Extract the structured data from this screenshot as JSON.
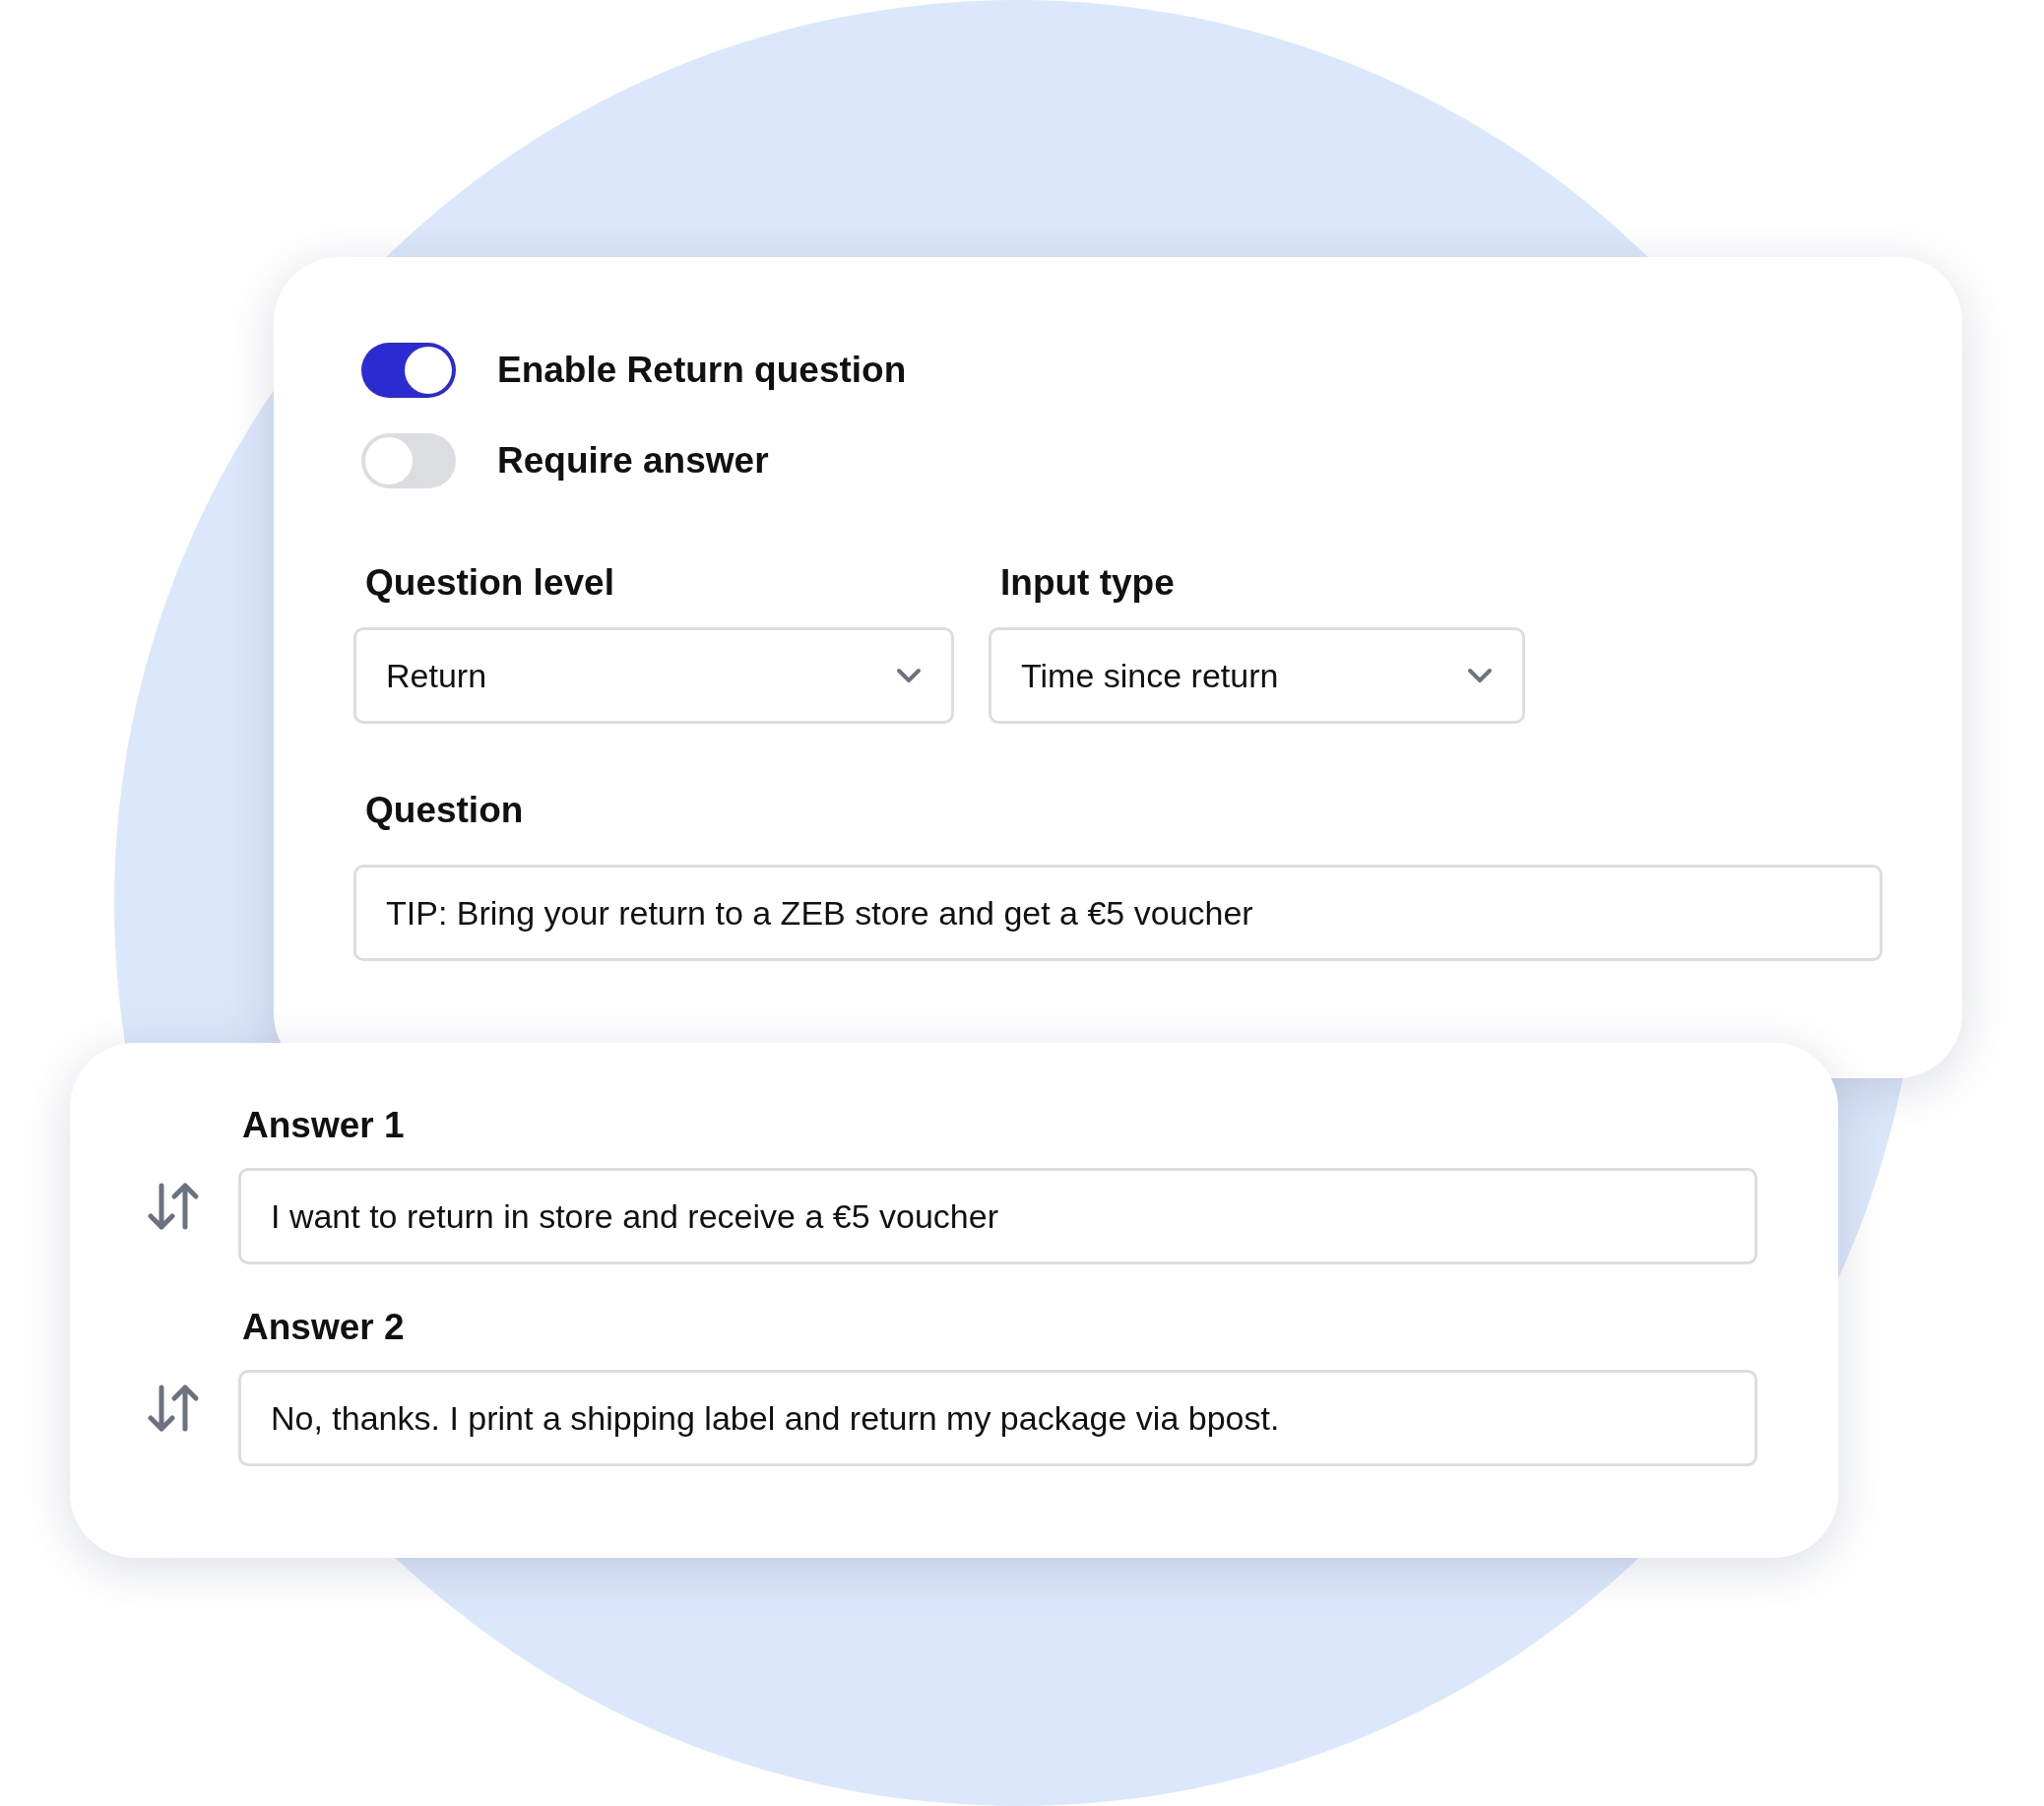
{
  "toggles": [
    {
      "label": "Enable Return question",
      "on": true
    },
    {
      "label": "Require answer",
      "on": false
    }
  ],
  "selects": [
    {
      "label": "Question level",
      "value": "Return"
    },
    {
      "label": "Input type",
      "value": "Time since return"
    }
  ],
  "question": {
    "label": "Question",
    "value": "TIP: Bring your return to a ZEB store and get a €5 voucher"
  },
  "answers": [
    {
      "label": "Answer 1",
      "value": "I want to return in store and receive a €5 voucher"
    },
    {
      "label": "Answer 2",
      "value": "No, thanks. I print a shipping label and return my package via bpost."
    }
  ]
}
